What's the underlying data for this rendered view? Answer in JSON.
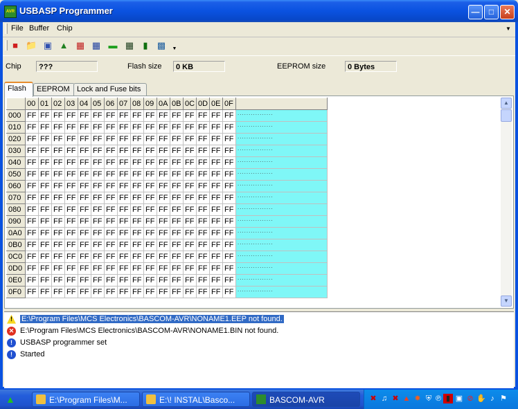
{
  "window": {
    "title": "USBASP Programmer",
    "icon_label": "AVR"
  },
  "menu": [
    "File",
    "Buffer",
    "Chip"
  ],
  "toolbar_icons": [
    "eraser-icon",
    "open-folder-icon",
    "save-icon",
    "read-chip-icon",
    "program-chip-icon",
    "verify-chip-icon",
    "chip-green-icon",
    "chip-read-flash-icon",
    "chip-write-icon",
    "chip-settings-icon"
  ],
  "info": {
    "chip_label": "Chip",
    "chip_value": "???",
    "flash_size_label": "Flash size",
    "flash_size_value": "0 KB",
    "eeprom_size_label": "EEPROM size",
    "eeprom_size_value": "0 Bytes"
  },
  "tabs": [
    {
      "label": "Flash",
      "active": true
    },
    {
      "label": "EEPROM",
      "active": false
    },
    {
      "label": "Lock and Fuse bits",
      "active": false
    }
  ],
  "hex": {
    "columns": [
      "00",
      "01",
      "02",
      "03",
      "04",
      "05",
      "06",
      "07",
      "08",
      "09",
      "0A",
      "0B",
      "0C",
      "0D",
      "0E",
      "0F"
    ],
    "rows": [
      "000",
      "010",
      "020",
      "030",
      "040",
      "050",
      "060",
      "070",
      "080",
      "090",
      "0A0",
      "0B0",
      "0C0",
      "0D0",
      "0E0",
      "0F0"
    ],
    "cell_value": "FF",
    "ascii_value": "................"
  },
  "log": [
    {
      "type": "warning",
      "text": "E:\\Program Files\\MCS Electronics\\BASCOM-AVR\\NONAME1.EEP not found.",
      "selected": true
    },
    {
      "type": "error",
      "text": "E:\\Program Files\\MCS Electronics\\BASCOM-AVR\\NONAME1.BIN not found.",
      "selected": false
    },
    {
      "type": "info",
      "text": "USBASP programmer set",
      "selected": false
    },
    {
      "type": "info",
      "text": "Started",
      "selected": false
    }
  ],
  "taskbar": {
    "buttons": [
      {
        "label": "E:\\Program Files\\M...",
        "active": false
      },
      {
        "label": "E:\\! INSTAL\\Basco...",
        "active": false
      },
      {
        "label": "BASCOM-AVR",
        "active": true
      }
    ]
  },
  "colors": {
    "ascii_bg": "#7FF7F7",
    "title_blue": "#0A52E0",
    "selection": "#316AC5"
  }
}
